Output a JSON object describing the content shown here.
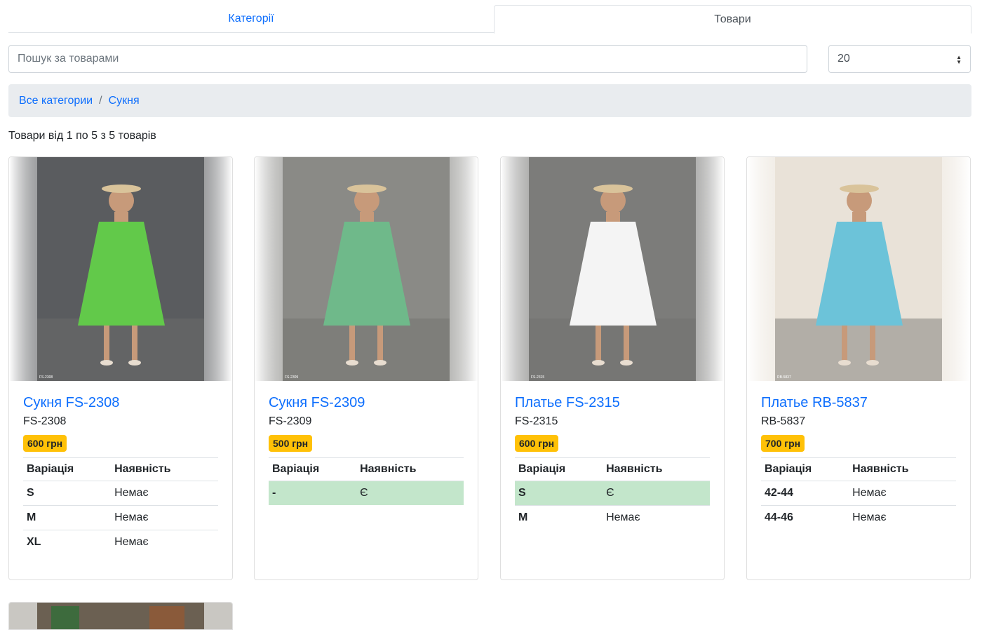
{
  "tabs": [
    {
      "label": "Категорії",
      "active": false
    },
    {
      "label": "Товари",
      "active": true
    }
  ],
  "search": {
    "placeholder": "Пошук за товарами",
    "value": ""
  },
  "per_page": {
    "selected": "20"
  },
  "breadcrumb": [
    {
      "label": "Все категории"
    },
    {
      "label": "Сукня"
    }
  ],
  "results_text": "Товари від 1 по 5 з 5 товарів",
  "table_headers": {
    "variation": "Варіація",
    "availability": "Наявність"
  },
  "colors": {
    "link": "#0d6efd",
    "price_badge": "#ffc107",
    "available_row": "#c3e6cb",
    "breadcrumb_bg": "#e9ecef"
  },
  "products": [
    {
      "title": "Сукня FS-2308",
      "sku": "FS-2308",
      "price": "600 грн",
      "image_code": "FS-2308",
      "image_colors": {
        "bg": "#5a5c5f",
        "dress": "#62c94a"
      },
      "variations": [
        {
          "name": "S",
          "availability": "Немає",
          "available": false
        },
        {
          "name": "M",
          "availability": "Немає",
          "available": false
        },
        {
          "name": "XL",
          "availability": "Немає",
          "available": false
        }
      ]
    },
    {
      "title": "Сукня FS-2309",
      "sku": "FS-2309",
      "price": "500 грн",
      "image_code": "FS-2309",
      "image_colors": {
        "bg": "#8a8a86",
        "dress": "#6fb98a"
      },
      "variations": [
        {
          "name": "-",
          "availability": "Є",
          "available": true
        }
      ]
    },
    {
      "title": "Платье FS-2315",
      "sku": "FS-2315",
      "price": "600 грн",
      "image_code": "FS-2315",
      "image_colors": {
        "bg": "#7c7c7a",
        "dress": "#f4f4f4"
      },
      "variations": [
        {
          "name": "S",
          "availability": "Є",
          "available": true
        },
        {
          "name": "M",
          "availability": "Немає",
          "available": false
        }
      ]
    },
    {
      "title": "Платье RB-5837",
      "sku": "RB-5837",
      "price": "700 грн",
      "image_code": "RB-5837",
      "image_colors": {
        "bg": "#e9e2d8",
        "dress": "#6cc3d9"
      },
      "variations": [
        {
          "name": "42-44",
          "availability": "Немає",
          "available": false
        },
        {
          "name": "44-46",
          "availability": "Немає",
          "available": false
        }
      ]
    }
  ]
}
